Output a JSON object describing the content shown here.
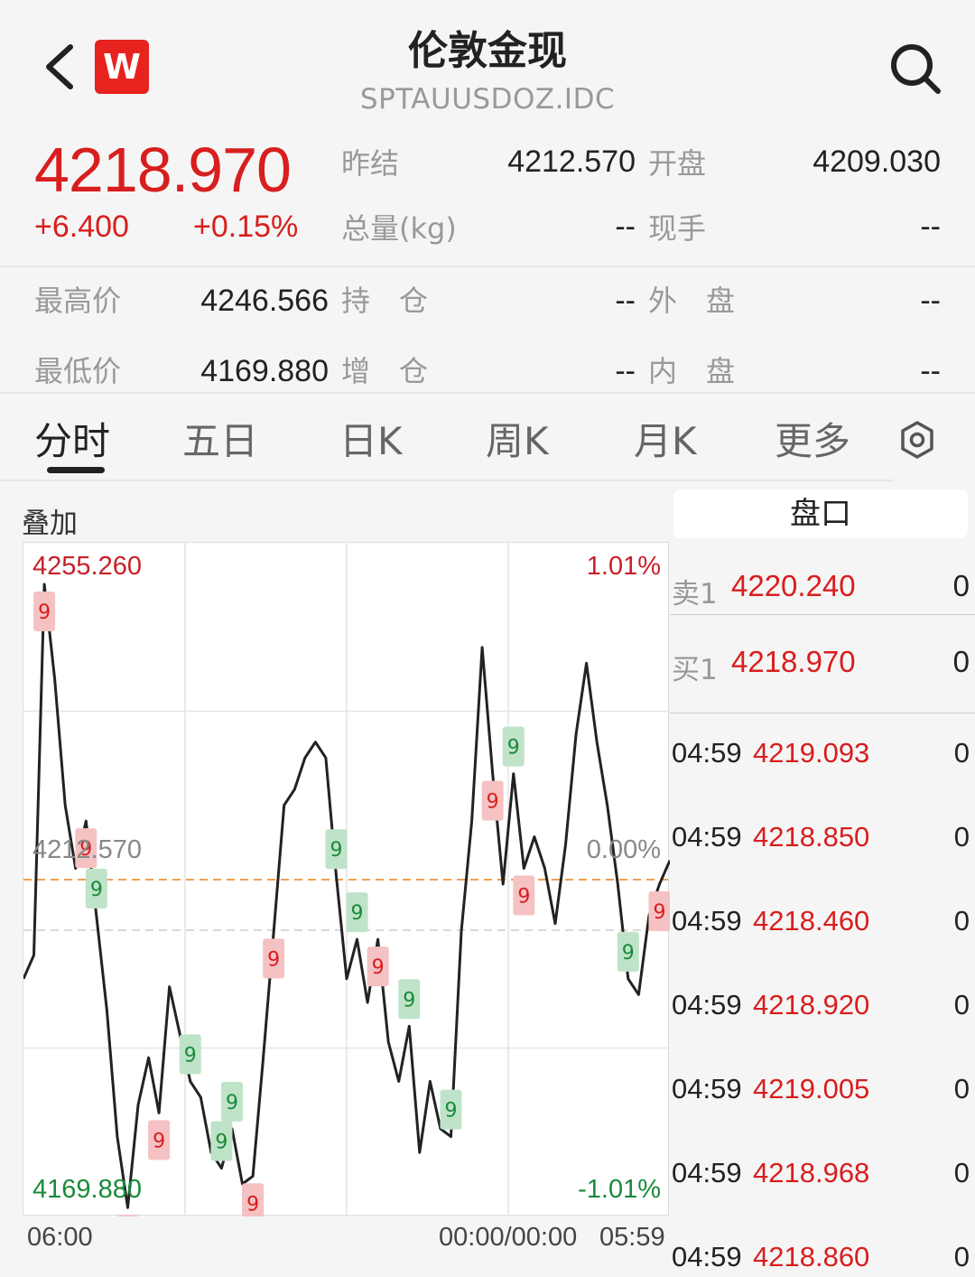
{
  "header": {
    "title": "伦敦金现",
    "subtitle": "SPTAUUSDOZ.IDC",
    "logo_text": "W",
    "icons": {
      "back": "chevron-left-icon",
      "search": "search-icon"
    }
  },
  "quote": {
    "price": "4218.970",
    "change": "+6.400",
    "change_pct": "+0.15%",
    "colors": {
      "up": "#d81e1e",
      "down": "#1a8a3a"
    },
    "fields": {
      "prev_settle_label": "昨结",
      "prev_settle": "4212.570",
      "open_label": "开盘",
      "open": "4209.030",
      "volume_label": "总量(kg)",
      "volume": "--",
      "current_hand_label": "现手",
      "current_hand": "--",
      "high_label": "最高价",
      "high": "4246.566",
      "open_interest_label": "持　仓",
      "open_interest": "--",
      "outer_label": "外　盘",
      "outer": "--",
      "low_label": "最低价",
      "low": "4169.880",
      "oi_change_label": "增　仓",
      "oi_change": "--",
      "inner_label": "内　盘",
      "inner": "--"
    }
  },
  "tabs": {
    "items": [
      "分时",
      "五日",
      "日K",
      "周K",
      "月K",
      "更多"
    ],
    "active": "分时",
    "settings_icon": "gear-icon"
  },
  "chart": {
    "overlay_label": "叠加",
    "y_max_label": "4255.260",
    "y_mid_label": "4212.570",
    "y_min_label": "4169.880",
    "pct_max_label": "1.01%",
    "pct_mid_label": "0.00%",
    "pct_min_label": "-1.01%",
    "time_start": "06:00",
    "time_mid": "00:00/00:00",
    "time_end": "05:59",
    "signal_marker_text": "9"
  },
  "chart_data": {
    "type": "line",
    "ylim": [
      4169.88,
      4255.26
    ],
    "reference_line": 4212.57,
    "series": [
      {
        "values": [
          4200,
          4203,
          4250,
          4238,
          4222,
          4214,
          4220,
          4208,
          4196,
          4180,
          4171,
          4184,
          4190,
          4183,
          4199,
          4193,
          4187,
          4185,
          4178,
          4176,
          4181,
          4174,
          4175,
          4190,
          4206,
          4222,
          4224,
          4228,
          4230,
          4228,
          4213,
          4200,
          4205,
          4197,
          4205,
          4192,
          4187,
          4194,
          4178,
          4187,
          4181,
          4180,
          4206,
          4220,
          4242,
          4226,
          4212,
          4226,
          4214,
          4218,
          4214,
          4207,
          4217,
          4231,
          4240,
          4230,
          4222,
          4212,
          4200,
          4198,
          4208,
          4212,
          4215
        ]
      }
    ],
    "signals": [
      {
        "index": 2,
        "type": "sell_setup"
      },
      {
        "index": 6,
        "type": "sell_setup"
      },
      {
        "index": 10,
        "type": "sell_setup"
      },
      {
        "index": 13,
        "type": "sell_setup"
      },
      {
        "index": 22,
        "type": "sell_setup"
      },
      {
        "index": 24,
        "type": "sell_setup"
      },
      {
        "index": 34,
        "type": "sell_setup"
      },
      {
        "index": 45,
        "type": "sell_setup"
      },
      {
        "index": 48,
        "type": "sell_setup"
      },
      {
        "index": 61,
        "type": "sell_setup"
      },
      {
        "index": 7,
        "type": "buy_setup"
      },
      {
        "index": 16,
        "type": "buy_setup"
      },
      {
        "index": 19,
        "type": "buy_setup"
      },
      {
        "index": 20,
        "type": "buy_setup"
      },
      {
        "index": 30,
        "type": "buy_setup"
      },
      {
        "index": 32,
        "type": "buy_setup"
      },
      {
        "index": 37,
        "type": "buy_setup"
      },
      {
        "index": 41,
        "type": "buy_setup"
      },
      {
        "index": 47,
        "type": "buy_setup"
      },
      {
        "index": 58,
        "type": "buy_setup"
      }
    ]
  },
  "order_book": {
    "header": "盘口",
    "sell": {
      "label": "卖1",
      "price": "4220.240",
      "qty": "0"
    },
    "buy": {
      "label": "买1",
      "price": "4218.970",
      "qty": "0"
    },
    "ticks": [
      {
        "time": "04:59",
        "price": "4219.093",
        "qty": "0"
      },
      {
        "time": "04:59",
        "price": "4218.850",
        "qty": "0"
      },
      {
        "time": "04:59",
        "price": "4218.460",
        "qty": "0"
      },
      {
        "time": "04:59",
        "price": "4218.920",
        "qty": "0"
      },
      {
        "time": "04:59",
        "price": "4219.005",
        "qty": "0"
      },
      {
        "time": "04:59",
        "price": "4218.968",
        "qty": "0"
      },
      {
        "time": "04:59",
        "price": "4218.860",
        "qty": "0"
      }
    ]
  }
}
